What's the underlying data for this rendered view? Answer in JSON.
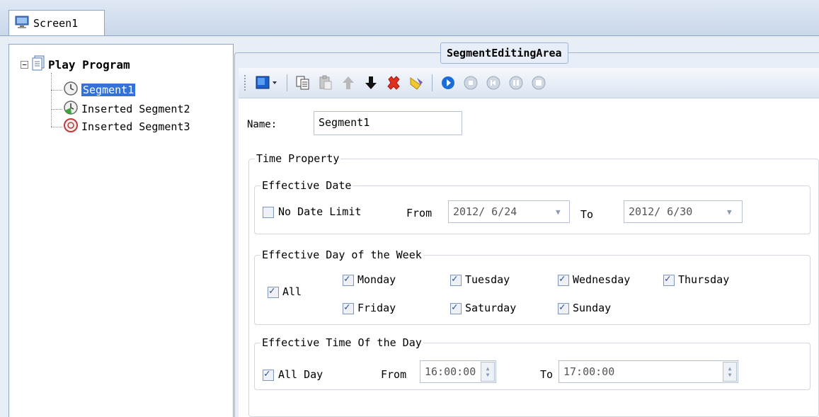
{
  "tab": {
    "label": "Screen1"
  },
  "tree": {
    "root": "Play Program",
    "items": [
      {
        "label": "Segment1",
        "selected": true
      },
      {
        "label": "Inserted Segment2",
        "selected": false
      },
      {
        "label": "Inserted Segment3",
        "selected": false
      }
    ],
    "expander": "−"
  },
  "editing_area": {
    "title": "SegmentEditingArea"
  },
  "toolbar": {
    "icons": [
      "color-dropdown-icon",
      "copy-icon",
      "paste-icon",
      "move-up-icon",
      "move-down-icon",
      "delete-icon",
      "clear-icon",
      "play-icon",
      "stop-icon",
      "previous-icon",
      "pause-icon",
      "end-icon"
    ]
  },
  "form": {
    "name_label": "Name:",
    "name_value": "Segment1",
    "time_property": "Time Property",
    "effective_date": {
      "title": "Effective Date",
      "no_date_limit": "No Date Limit",
      "no_date_limit_checked": false,
      "from_label": "From",
      "from_value": "2012/ 6/24",
      "to_label": "To",
      "to_value": "2012/ 6/30"
    },
    "effective_week": {
      "title": "Effective Day of the Week",
      "all": "All",
      "days": [
        "Monday",
        "Tuesday",
        "Wednesday",
        "Thursday",
        "Friday",
        "Saturday",
        "Sunday"
      ]
    },
    "effective_time": {
      "title": "Effective Time Of the Day",
      "all_day": "All Day",
      "from_label": "From",
      "from_value": "16:00:00",
      "to_label": "To",
      "to_value": "17:00:00"
    }
  }
}
